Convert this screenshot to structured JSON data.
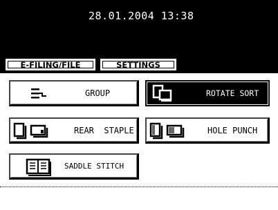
{
  "header": {
    "datetime": "28.01.2004 13:38"
  },
  "tabs": [
    {
      "label": "E-FILING/FILE"
    },
    {
      "label": "SETTINGS"
    }
  ],
  "buttons": {
    "group": {
      "label": "GROUP",
      "icon": "group-icon"
    },
    "rotate_sort": {
      "label": "ROTATE SORT",
      "icon": "rotate-sort-icon",
      "selected": true
    },
    "rear_staple": {
      "label": "REAR  STAPLE",
      "icon": "rear-staple-icon"
    },
    "hole_punch": {
      "label": "HOLE PUNCH",
      "icon": "hole-punch-icon"
    },
    "saddle_stitch": {
      "label": "SADDLE STITCH",
      "icon": "saddle-stitch-icon"
    }
  },
  "colors": {
    "background": "#ffffff",
    "header": "#000000",
    "selected": "#000000"
  }
}
